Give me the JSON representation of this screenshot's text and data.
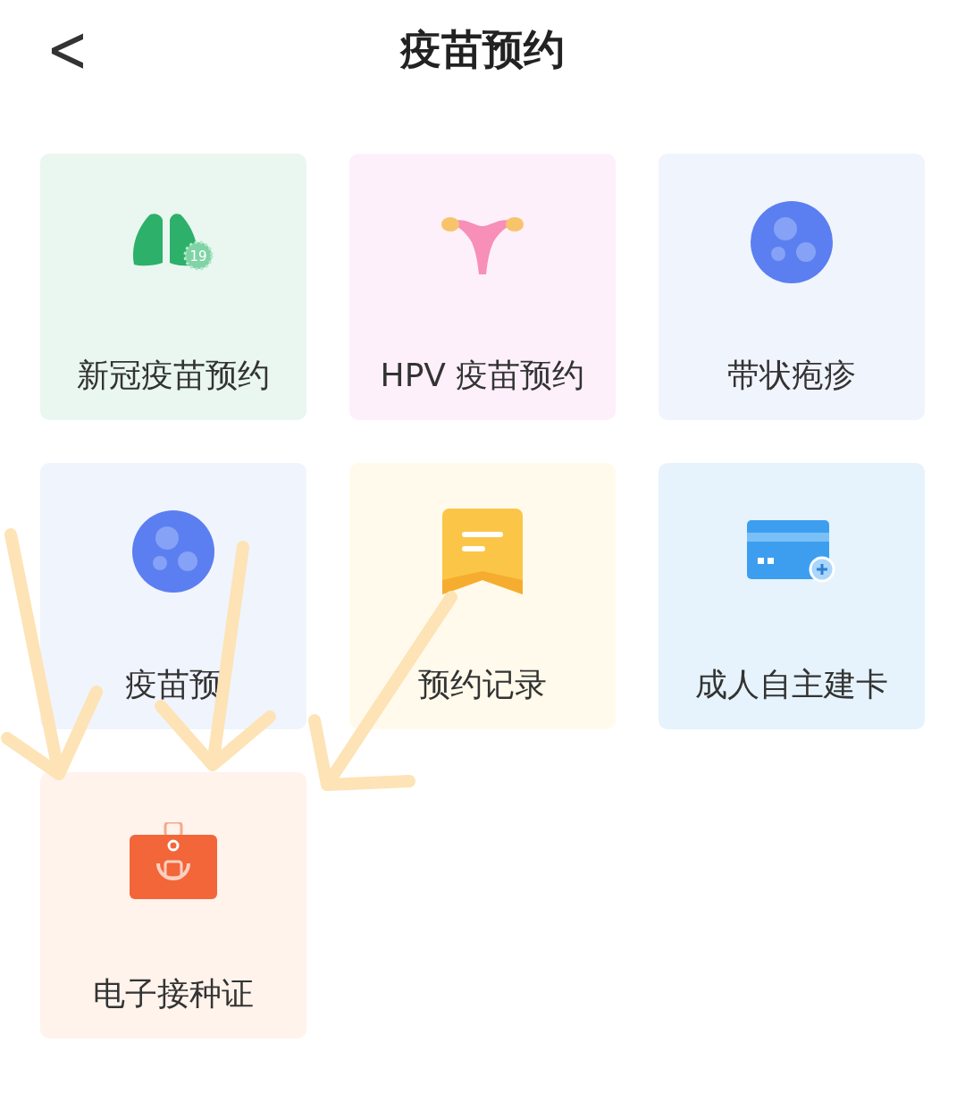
{
  "header": {
    "back": "<",
    "title": "疫苗预约"
  },
  "tiles": [
    {
      "label": "新冠疫苗预约",
      "kind": "lungs",
      "badge": "19",
      "color": "#e9f7f0"
    },
    {
      "label": "HPV 疫苗预约",
      "kind": "uterus",
      "color": "#fdf0fb"
    },
    {
      "label": "带状疱疹",
      "kind": "bubble",
      "color": "#f0f4fd"
    },
    {
      "label": "疫苗预",
      "kind": "bubble",
      "color": "#f0f4fd"
    },
    {
      "label": "预约记录",
      "kind": "note",
      "color": "#fffaeb"
    },
    {
      "label": "成人自主建卡",
      "kind": "card",
      "color": "#e6f3fc"
    },
    {
      "label": "电子接种证",
      "kind": "certificate",
      "color": "#fff3ec"
    }
  ]
}
